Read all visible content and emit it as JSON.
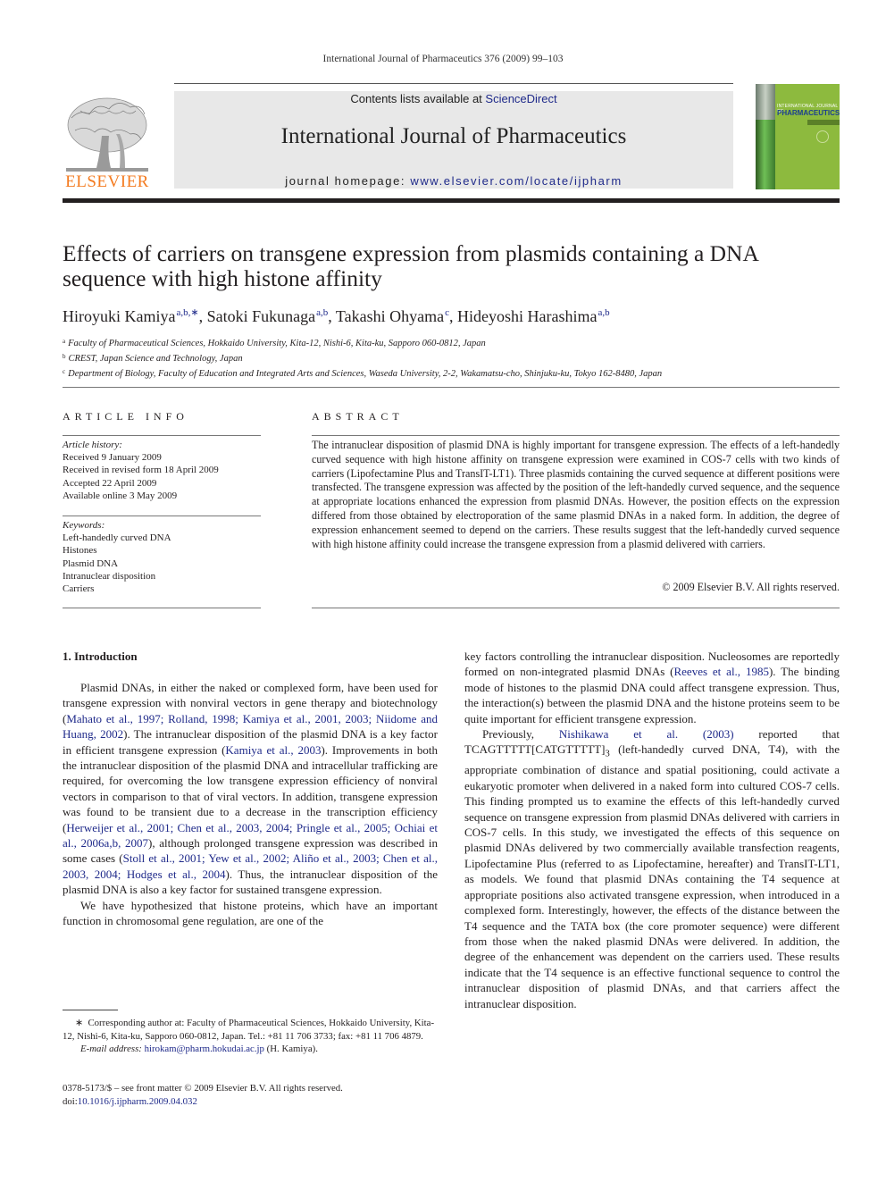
{
  "running_head": "International Journal of Pharmaceutics 376 (2009) 99–103",
  "masthead": {
    "publisher_logo_text": "ELSEVIER",
    "contents_prefix": "Contents lists available at ",
    "contents_link": "ScienceDirect",
    "journal_title": "International Journal of Pharmaceutics",
    "homepage_prefix": "journal homepage: ",
    "homepage_link": "www.elsevier.com/locate/ijpharm",
    "cover": {
      "line1": "INTERNATIONAL JOURNAL OF",
      "line2": "PHARMACEUTICS"
    },
    "colors": {
      "elsevier_orange": "#f47b20",
      "link_blue": "#1f2a8a",
      "cover_green": "#8dba3e",
      "box_gray": "#e8e8e8"
    }
  },
  "article": {
    "title": "Effects of carriers on transgene expression from plasmids containing a DNA sequence with high histone affinity",
    "authors": [
      {
        "name": "Hiroyuki Kamiya",
        "sup": "a,b,∗",
        "sep": ", "
      },
      {
        "name": "Satoki Fukunaga",
        "sup": "a,b",
        "sep": ", "
      },
      {
        "name": "Takashi Ohyama",
        "sup": "c",
        "sep": ", "
      },
      {
        "name": "Hideyoshi Harashima",
        "sup": "a,b",
        "sep": ""
      }
    ],
    "affiliations": [
      {
        "mark": "a",
        "text": "Faculty of Pharmaceutical Sciences, Hokkaido University, Kita-12, Nishi-6, Kita-ku, Sapporo 060-0812, Japan"
      },
      {
        "mark": "b",
        "text": "CREST, Japan Science and Technology, Japan"
      },
      {
        "mark": "c",
        "text": "Department of Biology, Faculty of Education and Integrated Arts and Sciences, Waseda University, 2-2, Wakamatsu-cho, Shinjuku-ku, Tokyo 162-8480, Japan"
      }
    ]
  },
  "article_info": {
    "heading": "ARTICLE INFO",
    "history_label": "Article history:",
    "history": [
      "Received 9 January 2009",
      "Received in revised form 18 April 2009",
      "Accepted 22 April 2009",
      "Available online 3 May 2009"
    ],
    "keywords_label": "Keywords:",
    "keywords": [
      "Left-handedly curved DNA",
      "Histones",
      "Plasmid DNA",
      "Intranuclear disposition",
      "Carriers"
    ]
  },
  "abstract": {
    "heading": "ABSTRACT",
    "text": "The intranuclear disposition of plasmid DNA is highly important for transgene expression. The effects of a left-handedly curved sequence with high histone affinity on transgene expression were examined in COS-7 cells with two kinds of carriers (Lipofectamine Plus and TransIT-LT1). Three plasmids containing the curved sequence at different positions were transfected. The transgene expression was affected by the position of the left-handedly curved sequence, and the sequence at appropriate locations enhanced the expression from plasmid DNAs. However, the position effects on the expression differed from those obtained by electroporation of the same plasmid DNAs in a naked form. In addition, the degree of expres­sion enhancement seemed to depend on the carriers. These results suggest that the left-handedly curved sequence with high histone affinity could increase the transgene expression from a plasmid delivered with carriers.",
    "copyright": "© 2009 Elsevier B.V. All rights reserved."
  },
  "introduction": {
    "heading": "1.  Introduction",
    "left_paragraphs": [
      [
        {
          "t": "Plasmid DNAs, in either the naked or complexed form, have been used for transgene expression with nonviral vectors in gene ther­apy and biotechnology ("
        },
        {
          "t": "Mahato et al., 1997; Rolland, 1998; Kamiya et al., 2001, 2003; Niidome and Huang, 2002",
          "link": true
        },
        {
          "t": "). The intranuclear disposition of the plasmid DNA is a key factor in efficient trans­gene expression ("
        },
        {
          "t": "Kamiya et al., 2003",
          "link": true
        },
        {
          "t": "). Improvements in both the intranuclear disposition of the plasmid DNA and intracellular traf­ficking are required, for overcoming the low transgene expression efficiency of nonviral vectors in comparison to that of viral vectors. In addition, transgene expression was found to be transient due to a decrease in the transcription efficiency ("
        },
        {
          "t": "Herweijer et al., 2001; Chen et al., 2003, 2004; Pringle et al., 2005; Ochiai et al., 2006a,b, 2007",
          "link": true
        },
        {
          "t": "), although prolonged transgene expression was described in some cases ("
        },
        {
          "t": "Stoll et al., 2001; Yew et al., 2002; Aliño et al., 2003; Chen et al., 2003, 2004; Hodges et al., 2004",
          "link": true
        },
        {
          "t": "). Thus, the intranuclear disposition of the plasmid DNA is also a key factor for sustained transgene expression."
        }
      ],
      [
        {
          "t": "We have hypothesized that histone proteins, which have an important function in chromosomal gene regulation, are one of the"
        }
      ]
    ],
    "right_paragraphs": [
      [
        {
          "t": "key factors controlling the intranuclear disposition. Nucleosomes are reportedly formed on non-integrated plasmid DNAs ("
        },
        {
          "t": "Reeves et al., 1985",
          "link": true
        },
        {
          "t": "). The binding mode of histones to the plasmid DNA could affect transgene expression. Thus, the interaction(s) between the plasmid DNA and the histone proteins seem to be quite important for efficient transgene expression."
        }
      ],
      [
        {
          "t": "Previously, "
        },
        {
          "t": "Nishikawa et al. (2003)",
          "link": true
        },
        {
          "t": " reported that TCAGTTTTT[CATGTTTTT]"
        },
        {
          "t": "3",
          "sub": true
        },
        {
          "t": " (left-handedly curved DNA, T4), with the appropriate combination of distance and spatial positioning, could activate a eukaryotic promoter when delivered in a naked form into cultured COS-7 cells. This finding prompted us to examine the effects of this left-handedly curved sequence on transgene expression from plasmid DNAs delivered with carriers in COS-7 cells. In this study, we investigated the effects of this sequence on plasmid DNAs delivered by two commercially available transfec­tion reagents, Lipofectamine Plus (referred to as Lipofectamine, hereafter) and TransIT-LT1, as models. We found that plasmid DNAs containing the T4 sequence at appropriate positions also activated transgene expression, when introduced in a complexed form. Interestingly, however, the effects of the distance between the T4 sequence and the TATA box (the core promoter sequence) were different from those when the naked plasmid DNAs were delivered. In addition, the degree of the enhancement was dependent on the carriers used. These results indicate that the T4 sequence is an effective functional sequence to control the intranuclear dispo­sition of plasmid DNAs, and that carriers affect the intranuclear disposition."
        }
      ]
    ]
  },
  "footnote": {
    "star": "∗",
    "corresponding": "Corresponding author at: Faculty of Pharmaceutical Sciences, Hokkaido University, Kita-12, Nishi-6, Kita-ku, Sapporo 060-0812, Japan. Tel.: +81 11 706 3733; fax: +81 11 706 4879.",
    "email_label": "E-mail address: ",
    "email": "hirokam@pharm.hokudai.ac.jp",
    "email_suffix": " (H. Kamiya)."
  },
  "front_matter": {
    "issn_line": "0378-5173/$ – see front matter © 2009 Elsevier B.V. All rights reserved.",
    "doi_prefix": "doi:",
    "doi": "10.1016/j.ijpharm.2009.04.032"
  }
}
